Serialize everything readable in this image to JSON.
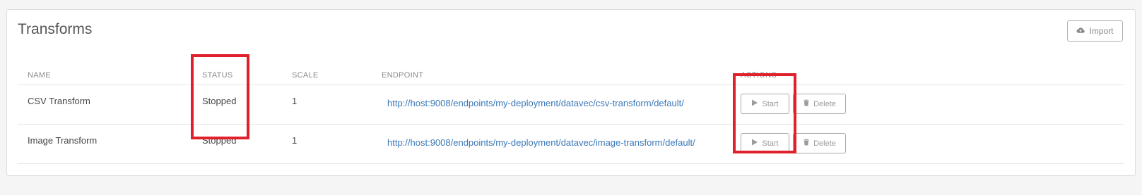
{
  "page": {
    "title": "Transforms",
    "import_label": "Import"
  },
  "table": {
    "headers": {
      "name": "NAME",
      "status": "STATUS",
      "scale": "SCALE",
      "endpoint": "ENDPOINT",
      "actions": "ACTIONS"
    },
    "rows": [
      {
        "name": "CSV Transform",
        "status": "Stopped",
        "scale": "1",
        "endpoint": "http://host:9008/endpoints/my-deployment/datavec/csv-transform/default/",
        "start_label": "Start",
        "delete_label": "Delete"
      },
      {
        "name": "Image Transform",
        "status": "Stopped",
        "scale": "1",
        "endpoint": "http://host:9008/endpoints/my-deployment/datavec/image-transform/default/",
        "start_label": "Start",
        "delete_label": "Delete"
      }
    ]
  },
  "colors": {
    "link": "#3a78b8",
    "highlight": "#e0202a",
    "muted": "#8a8a8a"
  },
  "icons": {
    "import": "cloud-upload-icon",
    "start": "play-icon",
    "delete": "trash-icon"
  }
}
